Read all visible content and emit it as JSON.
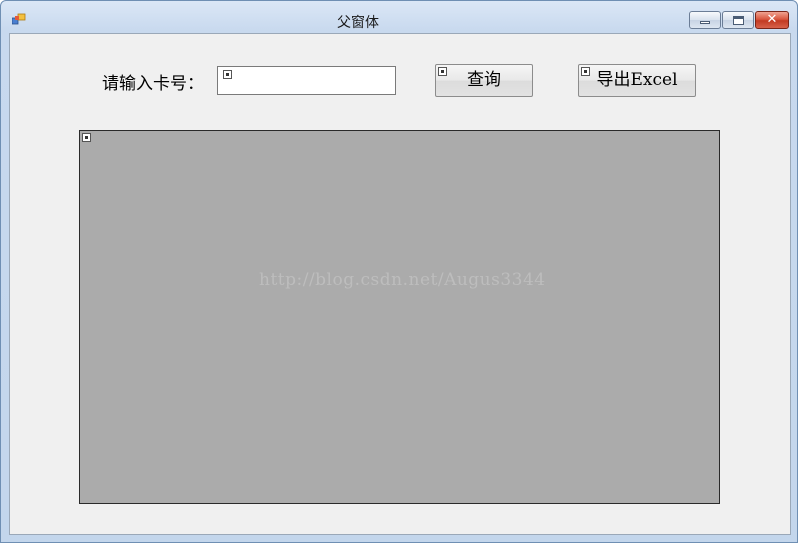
{
  "window": {
    "title": "父窗体",
    "icons": {
      "app": "app-icon",
      "minimize": "minimize-icon",
      "maximize": "maximize-icon",
      "close": "close-icon"
    }
  },
  "form": {
    "card_label": "请输入卡号：",
    "card_input": {
      "value": "",
      "placeholder": ""
    },
    "query_button": "查询",
    "export_button": "导出Excel"
  },
  "grid": {
    "watermark": "http://blog.csdn.net/Augus3344"
  },
  "colors": {
    "titlebar": "#c8d9ee",
    "client": "#f0f0f0",
    "grid_background": "#ababab",
    "close_button": "#c23a22"
  }
}
